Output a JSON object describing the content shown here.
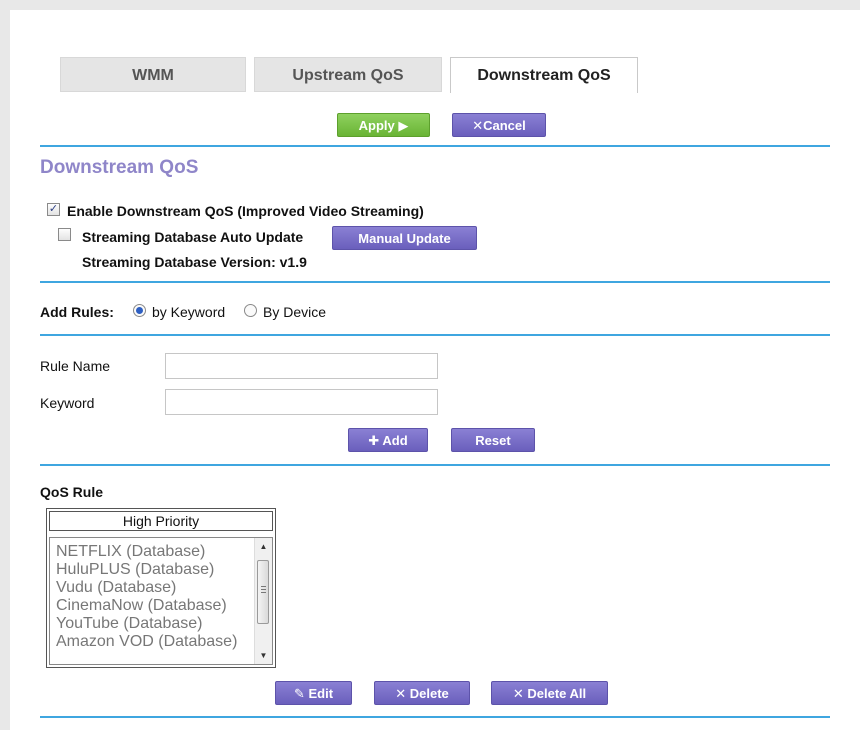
{
  "tabs": [
    {
      "label": "WMM",
      "active": false
    },
    {
      "label": "Upstream QoS",
      "active": false
    },
    {
      "label": "Downstream QoS",
      "active": true
    }
  ],
  "actions": {
    "apply_label": "Apply ▶",
    "cancel_label": "Cancel",
    "cancel_icon": "x-icon"
  },
  "section": {
    "title": "Downstream QoS"
  },
  "options": {
    "enable_downstream_label": "Enable Downstream QoS (Improved Video Streaming)",
    "enable_downstream_checked": true,
    "auto_update_label": "Streaming Database Auto Update",
    "auto_update_checked": false,
    "manual_update_label": "Manual Update",
    "db_version_text": "Streaming Database Version: v1.9"
  },
  "add_rules": {
    "label": "Add Rules:",
    "by_keyword_label": "by Keyword",
    "by_device_label": "By Device",
    "selected": "by Keyword"
  },
  "form": {
    "rule_name_label": "Rule Name",
    "rule_name_value": "",
    "keyword_label": "Keyword",
    "keyword_value": "",
    "add_label": "Add",
    "reset_label": "Reset"
  },
  "qos_rule": {
    "title": "QoS Rule",
    "priority_header": "High Priority",
    "items": [
      "NETFLIX (Database)",
      "HuluPLUS (Database)",
      "Vudu (Database)",
      "CinemaNow (Database)",
      "YouTube (Database)",
      "Amazon VOD (Database)"
    ]
  },
  "rule_actions": {
    "edit_label": "Edit",
    "delete_label": "Delete",
    "delete_all_label": "Delete All"
  },
  "colors": {
    "accent_line": "#3fa6e0",
    "title_purple": "#8f86c9",
    "button_purple": "#6a5fbc",
    "button_green": "#69b435"
  }
}
